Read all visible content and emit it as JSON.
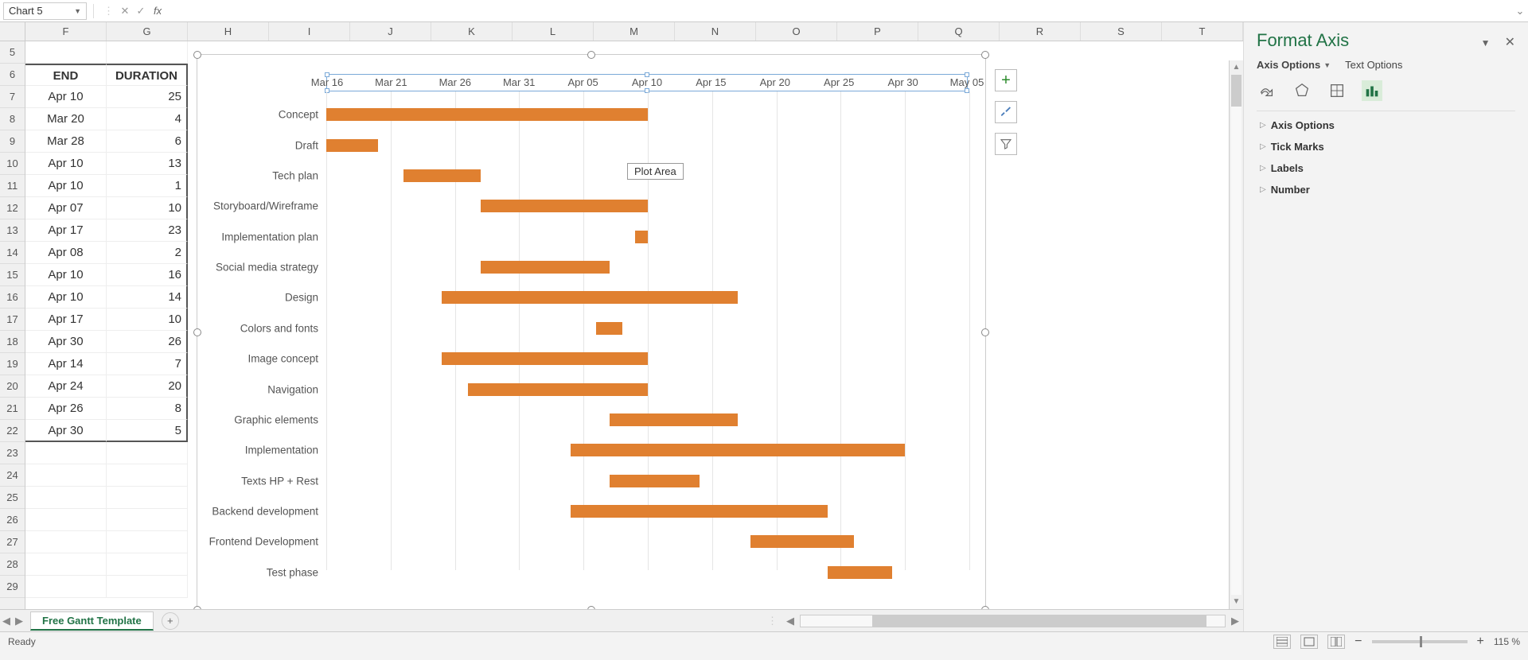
{
  "name_box": "Chart 5",
  "formula": "",
  "fx_label": "fx",
  "columns": [
    "F",
    "G",
    "H",
    "I",
    "J",
    "K",
    "L",
    "M",
    "N",
    "O",
    "P",
    "Q",
    "R",
    "S",
    "T"
  ],
  "row_start": 5,
  "row_end": 29,
  "table": {
    "headers": {
      "end": "END",
      "duration": "DURATION"
    },
    "rows": [
      {
        "end": "Apr 10",
        "dur": "25"
      },
      {
        "end": "Mar 20",
        "dur": "4"
      },
      {
        "end": "Mar 28",
        "dur": "6"
      },
      {
        "end": "Apr 10",
        "dur": "13"
      },
      {
        "end": "Apr 10",
        "dur": "1"
      },
      {
        "end": "Apr 07",
        "dur": "10"
      },
      {
        "end": "Apr 17",
        "dur": "23"
      },
      {
        "end": "Apr 08",
        "dur": "2"
      },
      {
        "end": "Apr 10",
        "dur": "16"
      },
      {
        "end": "Apr 10",
        "dur": "14"
      },
      {
        "end": "Apr 17",
        "dur": "10"
      },
      {
        "end": "Apr 30",
        "dur": "26"
      },
      {
        "end": "Apr 14",
        "dur": "7"
      },
      {
        "end": "Apr 24",
        "dur": "20"
      },
      {
        "end": "Apr 26",
        "dur": "8"
      },
      {
        "end": "Apr 30",
        "dur": "5"
      }
    ]
  },
  "chart_data": {
    "type": "bar",
    "orientation": "horizontal-gantt",
    "x_axis_ticks": [
      "Mar 16",
      "Mar 21",
      "Mar 26",
      "Mar 31",
      "Apr 05",
      "Apr 10",
      "Apr 15",
      "Apr 20",
      "Apr 25",
      "Apr 30",
      "May 05"
    ],
    "x_min": "Mar 16",
    "x_max": "May 05",
    "tooltip": "Plot Area",
    "tasks": [
      {
        "name": "Concept",
        "start": "Mar 16",
        "end": "Apr 10",
        "start_pct": 0.0,
        "dur_pct": 0.5
      },
      {
        "name": "Draft",
        "start": "Mar 16",
        "end": "Mar 20",
        "start_pct": 0.0,
        "dur_pct": 0.08
      },
      {
        "name": "Tech plan",
        "start": "Mar 22",
        "end": "Mar 28",
        "start_pct": 0.12,
        "dur_pct": 0.12
      },
      {
        "name": "Storyboard/Wireframe",
        "start": "Mar 28",
        "end": "Apr 10",
        "start_pct": 0.24,
        "dur_pct": 0.26
      },
      {
        "name": "Implementation plan",
        "start": "Apr 09",
        "end": "Apr 10",
        "start_pct": 0.48,
        "dur_pct": 0.02
      },
      {
        "name": "Social media strategy",
        "start": "Mar 28",
        "end": "Apr 07",
        "start_pct": 0.24,
        "dur_pct": 0.2
      },
      {
        "name": "Design",
        "start": "Mar 25",
        "end": "Apr 17",
        "start_pct": 0.18,
        "dur_pct": 0.46
      },
      {
        "name": "Colors and fonts",
        "start": "Apr 06",
        "end": "Apr 08",
        "start_pct": 0.42,
        "dur_pct": 0.04
      },
      {
        "name": "Image concept",
        "start": "Mar 25",
        "end": "Apr 10",
        "start_pct": 0.18,
        "dur_pct": 0.32
      },
      {
        "name": "Navigation",
        "start": "Mar 27",
        "end": "Apr 10",
        "start_pct": 0.22,
        "dur_pct": 0.28
      },
      {
        "name": "Graphic elements",
        "start": "Apr 07",
        "end": "Apr 17",
        "start_pct": 0.44,
        "dur_pct": 0.2
      },
      {
        "name": "Implementation",
        "start": "Apr 04",
        "end": "Apr 30",
        "start_pct": 0.38,
        "dur_pct": 0.52
      },
      {
        "name": "Texts HP + Rest",
        "start": "Apr 07",
        "end": "Apr 14",
        "start_pct": 0.44,
        "dur_pct": 0.14
      },
      {
        "name": "Backend development",
        "start": "Apr 04",
        "end": "Apr 24",
        "start_pct": 0.38,
        "dur_pct": 0.4
      },
      {
        "name": "Frontend Development",
        "start": "Apr 18",
        "end": "Apr 26",
        "start_pct": 0.66,
        "dur_pct": 0.16
      },
      {
        "name": "Test phase",
        "start": "Apr 25",
        "end": "Apr 30",
        "start_pct": 0.78,
        "dur_pct": 0.1
      }
    ],
    "bar_color": "#e08030"
  },
  "chart_buttons": {
    "plus": "+",
    "brush": "brush",
    "filter": "filter"
  },
  "panel": {
    "title": "Format Axis",
    "tabs": {
      "axis_options": "Axis Options",
      "text_options": "Text Options"
    },
    "sections": [
      "Axis Options",
      "Tick Marks",
      "Labels",
      "Number"
    ]
  },
  "sheet_tab": "Free Gantt Template",
  "status": {
    "ready": "Ready",
    "zoom": "115 %"
  }
}
